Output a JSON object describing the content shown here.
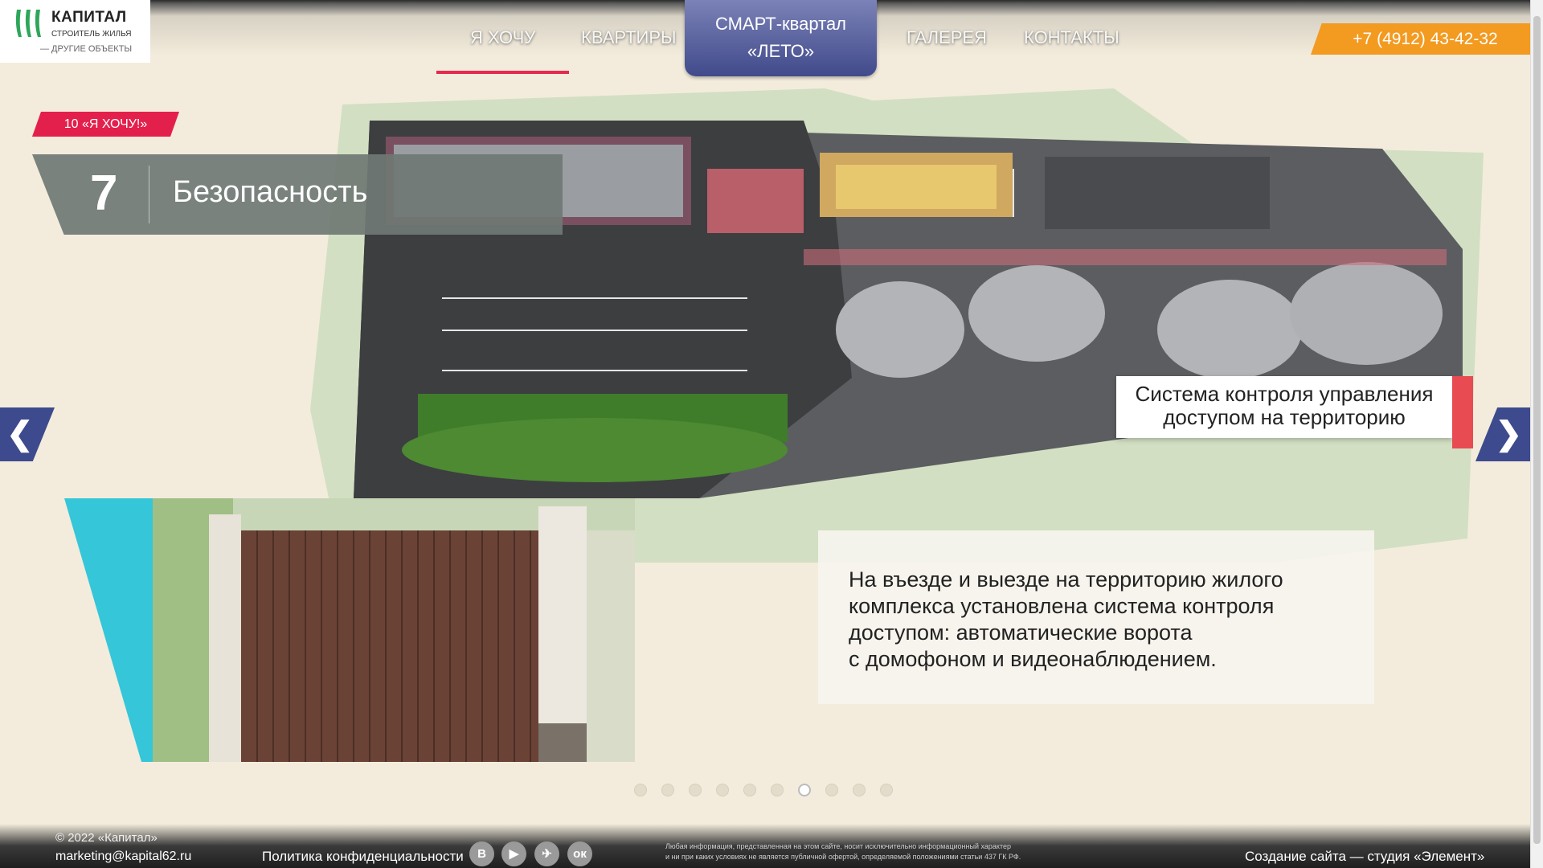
{
  "logo": {
    "name": "КАПИТАЛ",
    "tagline": "СТРОИТЕЛЬ ЖИЛЬЯ",
    "other": "— ДРУГИЕ ОБЪЕКТЫ"
  },
  "nav": {
    "items": [
      {
        "label": "Я ХОЧУ"
      },
      {
        "label": "КВАРТИРЫ"
      },
      {
        "label": "ГАЛЕРЕЯ"
      },
      {
        "label": "КОНТАКТЫ"
      }
    ],
    "center_line1": "СМАРТ-квартал",
    "center_line2": "«ЛЕТО»",
    "active": "Я ХОЧУ"
  },
  "phone": "+7 (4912) 43-42-32",
  "slide": {
    "badge": "10 «Я ХОЧУ!»",
    "number": "7",
    "title": "Безопасность",
    "callout_line1": "Система контроля управления",
    "callout_line2": "доступом на территорию",
    "description": [
      "На въезде и выезде на территорию жилого",
      "комплекса установлена система контроля",
      "доступом: автоматические ворота",
      "с домофоном и видеонаблюдением."
    ]
  },
  "pagination": {
    "total": 10,
    "active_index": 6
  },
  "footer": {
    "copyright": "© 2022 «Капитал»",
    "email": "marketing@kapital62.ru",
    "privacy": "Политика конфиденциальности",
    "social": [
      "В",
      "▶",
      "✈",
      "ок"
    ],
    "legal_line1": "Любая информация, представленная на этом сайте, носит исключительно информационный характер",
    "legal_line2": "и ни при каких условиях не является публичной офертой, определяемой положениями статьи 437 ГК РФ.",
    "studio": "Создание сайта — студия «Элемент»"
  },
  "colors": {
    "accent_red": "#e3204c",
    "nav_blue": "#414a8b",
    "phone_orange": "#f39a20",
    "cyan": "#35c6d9"
  }
}
